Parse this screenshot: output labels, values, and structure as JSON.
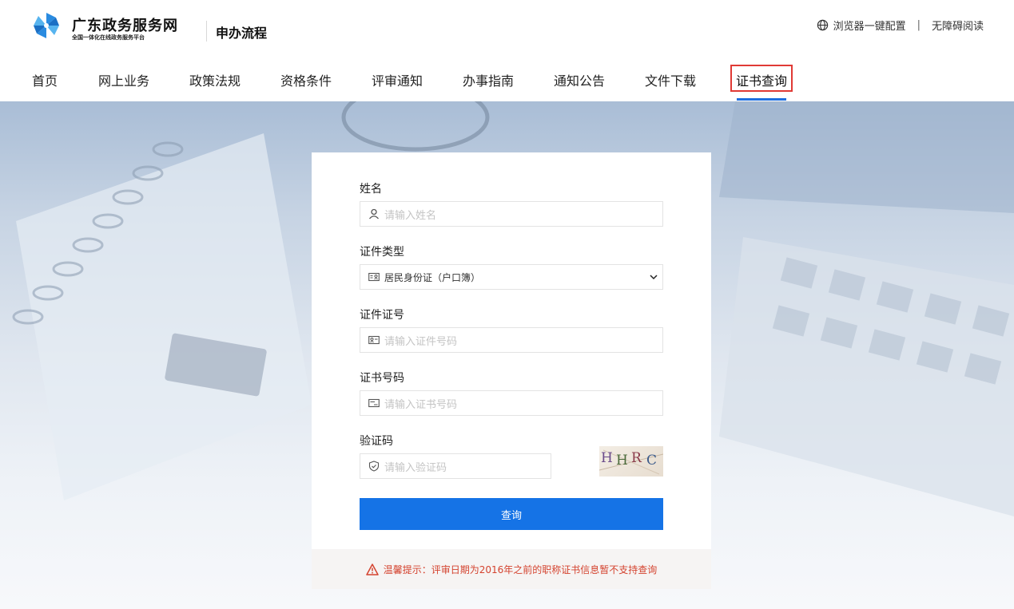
{
  "header": {
    "brand_title": "广东政务服务网",
    "brand_subtitle": "全国一体化在线政务服务平台",
    "section_title": "申办流程",
    "browser_config": "浏览器一键配置",
    "separator": "|",
    "accessibility": "无障碍阅读"
  },
  "nav": {
    "items": [
      {
        "label": "首页"
      },
      {
        "label": "网上业务"
      },
      {
        "label": "政策法规"
      },
      {
        "label": "资格条件"
      },
      {
        "label": "评审通知"
      },
      {
        "label": "办事指南"
      },
      {
        "label": "通知公告"
      },
      {
        "label": "文件下载"
      },
      {
        "label": "证书查询"
      }
    ],
    "active_index": 8
  },
  "form": {
    "name_label": "姓名",
    "name_placeholder": "请输入姓名",
    "id_type_label": "证件类型",
    "id_type_value": "居民身份证（户口簿）",
    "id_number_label": "证件证号",
    "id_number_placeholder": "请输入证件号码",
    "cert_number_label": "证书号码",
    "cert_number_placeholder": "请输入证书号码",
    "captcha_label": "验证码",
    "captcha_placeholder": "请输入验证码",
    "captcha_text": "HHRC",
    "submit_label": "查询"
  },
  "notice": {
    "text": "温馨提示：评审日期为2016年之前的职称证书信息暂不支持查询"
  },
  "colors": {
    "accent": "#1573e6",
    "active_outline": "#e03a35",
    "warning": "#d4432f"
  },
  "icons": [
    "pinwheel-logo-icon",
    "globe-icon",
    "user-icon",
    "id-card-icon",
    "certificate-icon",
    "shield-icon",
    "chevron-down-icon",
    "warning-icon"
  ]
}
